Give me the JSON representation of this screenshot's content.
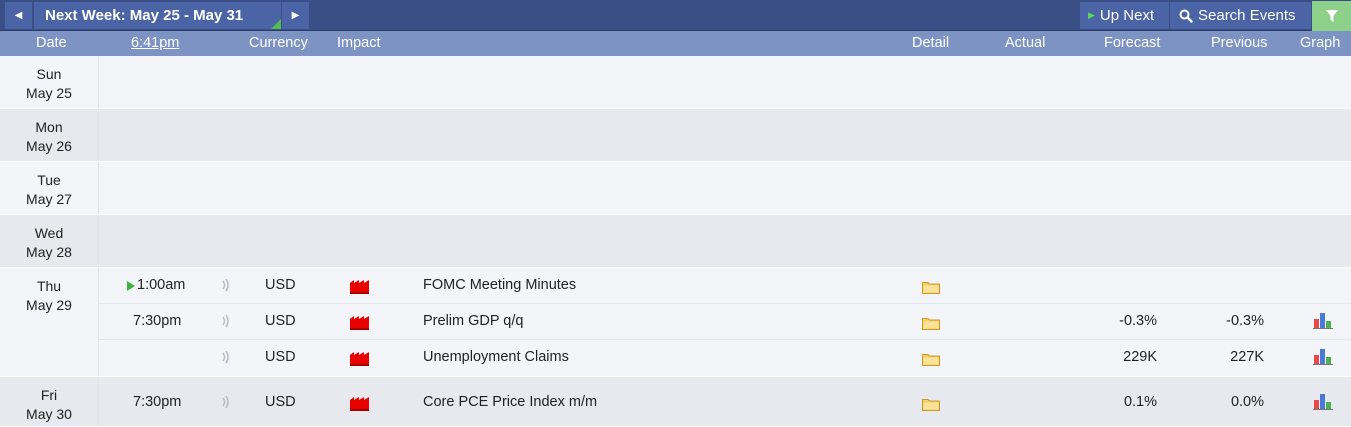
{
  "nav": {
    "prev_glyph": "◀",
    "next_glyph": "▶",
    "week_label": "Next Week: May 25 - May 31",
    "up_next": "Up Next",
    "search": "Search Events"
  },
  "columns": {
    "date": "Date",
    "time": "6:41pm",
    "currency": "Currency",
    "impact": "Impact",
    "detail": "Detail",
    "actual": "Actual",
    "forecast": "Forecast",
    "previous": "Previous",
    "graph": "Graph"
  },
  "colors": {
    "topbar": "#3a4f86",
    "header": "#7d93c4",
    "impact_high": "#e60000",
    "accent_green": "#8cd08a"
  },
  "days": [
    {
      "dow": "Sun",
      "date": "May 25",
      "events": []
    },
    {
      "dow": "Mon",
      "date": "May 26",
      "events": []
    },
    {
      "dow": "Tue",
      "date": "May 27",
      "events": []
    },
    {
      "dow": "Wed",
      "date": "May 28",
      "events": []
    },
    {
      "dow": "Thu",
      "date": "May 29",
      "events": [
        {
          "time": "1:00am",
          "upnext": true,
          "currency": "USD",
          "impact": "high",
          "name": "FOMC Meeting Minutes",
          "forecast": "",
          "previous": "",
          "graph": false
        },
        {
          "time": "7:30pm",
          "upnext": false,
          "currency": "USD",
          "impact": "high",
          "name": "Prelim GDP q/q",
          "forecast": "-0.3%",
          "previous": "-0.3%",
          "graph": true
        },
        {
          "time": "",
          "upnext": false,
          "currency": "USD",
          "impact": "high",
          "name": "Unemployment Claims",
          "forecast": "229K",
          "previous": "227K",
          "graph": true
        }
      ]
    },
    {
      "dow": "Fri",
      "date": "May 30",
      "events": [
        {
          "time": "7:30pm",
          "upnext": false,
          "currency": "USD",
          "impact": "high",
          "name": "Core PCE Price Index m/m",
          "forecast": "0.1%",
          "previous": "0.0%",
          "graph": true
        }
      ]
    }
  ]
}
